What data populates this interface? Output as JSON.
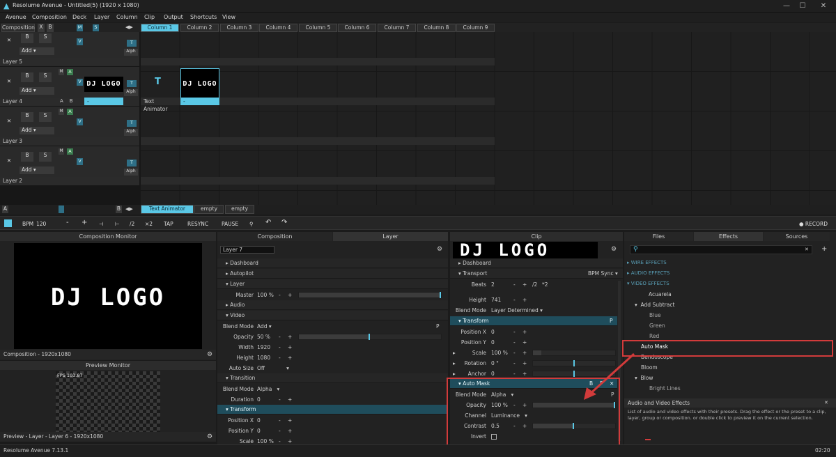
{
  "window": {
    "title": "Resolume Avenue - Untitled(5) (1920 x 1080)",
    "min": "—",
    "max": "☐",
    "close": "✕"
  },
  "menu": [
    "Avenue",
    "Composition",
    "Deck",
    "Layer",
    "Column",
    "Clip",
    "Output",
    "Shortcuts",
    "View"
  ],
  "comp_header": {
    "label": "Composition",
    "x": "X",
    "b": "B",
    "m": "M",
    "s": "S"
  },
  "columns": [
    "Column 1",
    "Column 2",
    "Column 3",
    "Column 4",
    "Column 5",
    "Column 6",
    "Column 7",
    "Column 8",
    "Column 9"
  ],
  "layers": [
    {
      "name": "Layer 5",
      "add": "Add"
    },
    {
      "name": "Layer 4",
      "add": "Add",
      "clip1": "DJ LOGO",
      "clip2": "Text Animator",
      "clip3": "DJ LOGO",
      "lbl1": "-",
      "lbl3": "-"
    },
    {
      "name": "Layer 3",
      "add": "Add"
    },
    {
      "name": "Layer 2",
      "add": "Add"
    }
  ],
  "layer_btns": {
    "x": "✕",
    "b": "B",
    "s": "S",
    "m": "M",
    "a": "A",
    "v": "V",
    "t": "T",
    "alph": "Alph",
    "ab_a": "A",
    "ab_b": "B"
  },
  "deck": {
    "a": "A",
    "b": "B",
    "tabs": [
      "Text Animator",
      "empty",
      "empty"
    ]
  },
  "transport": {
    "bpm_label": "BPM",
    "bpm": "120",
    "minus": "-",
    "plus": "+",
    "half": "/2",
    "double": "×2",
    "tap": "TAP",
    "resync": "RESYNC",
    "pause": "PAUSE",
    "record": "● RECORD"
  },
  "comp_monitor": {
    "title": "Composition Monitor",
    "text": "DJ LOGO",
    "footer": "Composition - 1920x1080"
  },
  "preview_monitor": {
    "title": "Preview Monitor",
    "fps": "FPS 103.87",
    "footer": "Preview - Layer - Layer 6 - 1920x1080"
  },
  "layer_panel": {
    "tabs": [
      "Composition",
      "Layer"
    ],
    "name": "Layer 7",
    "sections": {
      "dashboard": "Dashboard",
      "autopilot": "Autopilot",
      "layer": "Layer",
      "audio": "Audio",
      "video": "Video",
      "transition": "Transition",
      "transform": "Transform"
    },
    "master": {
      "label": "Master",
      "value": "100 %",
      "level": 1.0
    },
    "blend": {
      "label": "Blend Mode",
      "value": "Add"
    },
    "opacity": {
      "label": "Opacity",
      "value": "50 %",
      "level": 0.5
    },
    "width": {
      "label": "Width",
      "value": "1920"
    },
    "height": {
      "label": "Height",
      "value": "1080"
    },
    "autosize": {
      "label": "Auto Size",
      "value": "Off"
    },
    "t_blend": {
      "label": "Blend Mode",
      "value": "Alpha"
    },
    "duration": {
      "label": "Duration",
      "value": "0"
    },
    "posx": {
      "label": "Position X",
      "value": "0"
    },
    "posy": {
      "label": "Position Y",
      "value": "0"
    },
    "scale": {
      "label": "Scale",
      "value": "100 %"
    }
  },
  "clip_panel": {
    "title": "Clip",
    "thumb": "DJ LOGO",
    "dashboard": "Dashboard",
    "transport": "Transport",
    "bpm_sync": "BPM Sync",
    "beats": {
      "label": "Beats",
      "value": "2",
      "half": "/2",
      "double": "*2"
    },
    "height": {
      "label": "Height",
      "value": "741"
    },
    "blend": {
      "label": "Blend Mode",
      "value": "Layer Determined"
    },
    "transform": "Transform",
    "posx": {
      "label": "Position X",
      "value": "0"
    },
    "posy": {
      "label": "Position Y",
      "value": "0"
    },
    "scale": {
      "label": "Scale",
      "value": "100 %"
    },
    "rotation": {
      "label": "Rotation",
      "value": "0 °"
    },
    "anchor": {
      "label": "Anchor",
      "value": "0"
    },
    "automask": {
      "title": "Auto Mask",
      "b": "B",
      "p": "P",
      "x": "✕"
    },
    "am_blend": {
      "label": "Blend Mode",
      "value": "Alpha"
    },
    "am_opacity": {
      "label": "Opacity",
      "value": "100 %",
      "level": 1.0
    },
    "am_channel": {
      "label": "Channel",
      "value": "Luminance"
    },
    "am_contrast": {
      "label": "Contrast",
      "value": "0.5",
      "level": 0.5
    },
    "am_invert": {
      "label": "Invert"
    }
  },
  "browser": {
    "tabs": [
      "Files",
      "Effects",
      "Sources"
    ],
    "cats": [
      "WIRE EFFECTS",
      "AUDIO EFFECTS",
      "VIDEO EFFECTS"
    ],
    "items": [
      "Acuarela",
      "Add Subtract",
      "Blue",
      "Green",
      "Red",
      "Auto Mask",
      "Bendoscope",
      "Bloom",
      "Blow",
      "Bright Lines"
    ],
    "help_title": "Audio and Video Effects",
    "help_text": "List of audio and video effects with their presets. Drag the effect or the preset to a clip, layer, group or composition. or double click to preview it on the current selection."
  },
  "status": {
    "version": "Resolume Avenue 7.13.1",
    "time": "02:20"
  },
  "colors": {
    "accent": "#5ac8e6",
    "highlight_red": "#d23b3b"
  }
}
